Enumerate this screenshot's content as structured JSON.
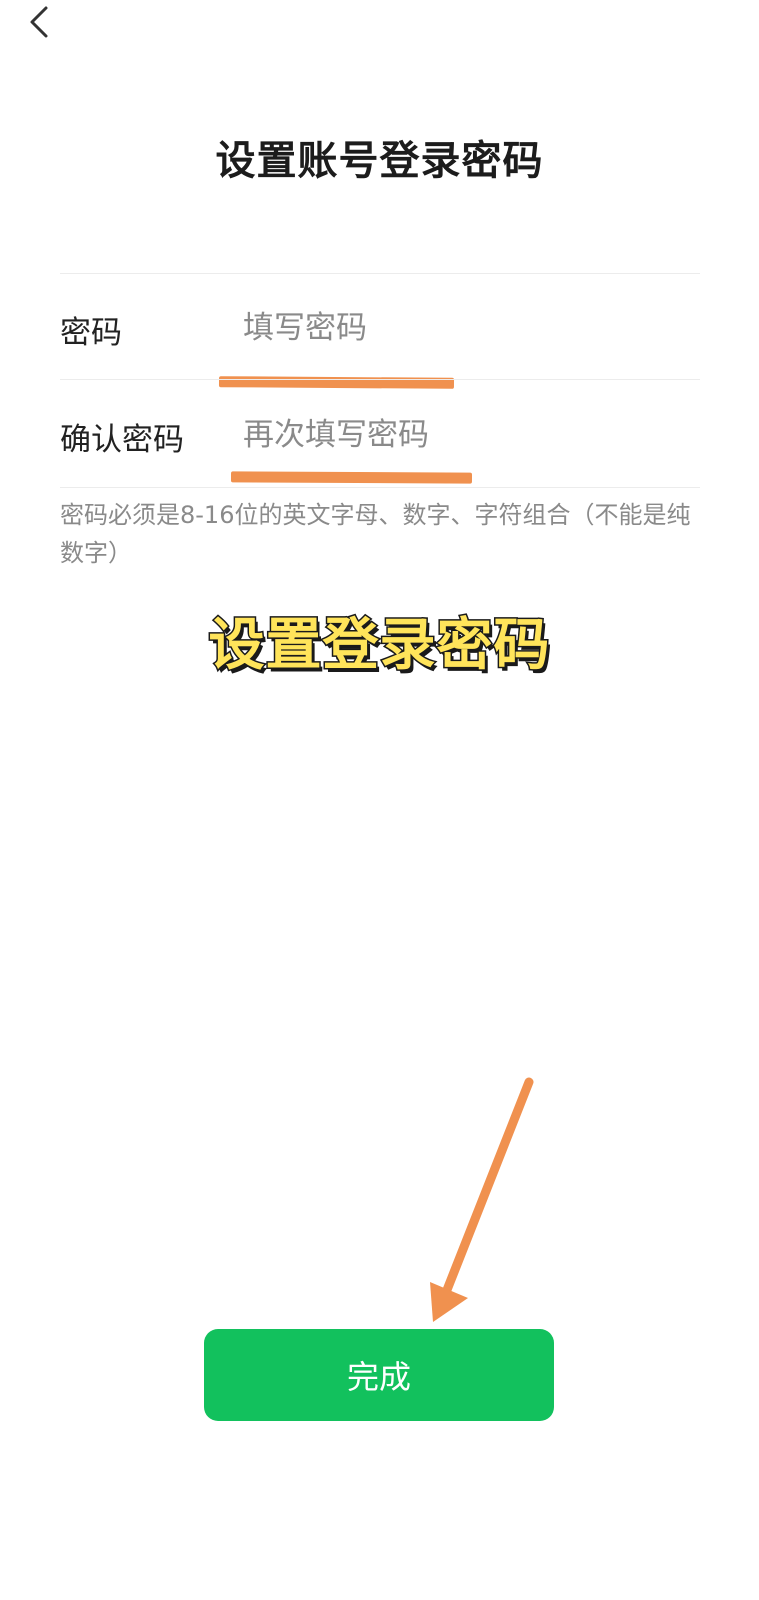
{
  "header": {
    "back_icon": "chevron-left-icon",
    "title": "设置账号登录密码"
  },
  "form": {
    "password": {
      "label": "密码",
      "placeholder": "填写密码",
      "value": ""
    },
    "confirm_password": {
      "label": "确认密码",
      "placeholder": "再次填写密码",
      "value": ""
    },
    "hint": "密码必须是8-16位的英文字母、数字、字符组合（不能是纯数字）"
  },
  "annotation": {
    "caption": "设置登录密码",
    "highlight_color": "#f0914f",
    "caption_color": "#ffe45a"
  },
  "actions": {
    "done_label": "完成",
    "done_color": "#12c15d"
  }
}
